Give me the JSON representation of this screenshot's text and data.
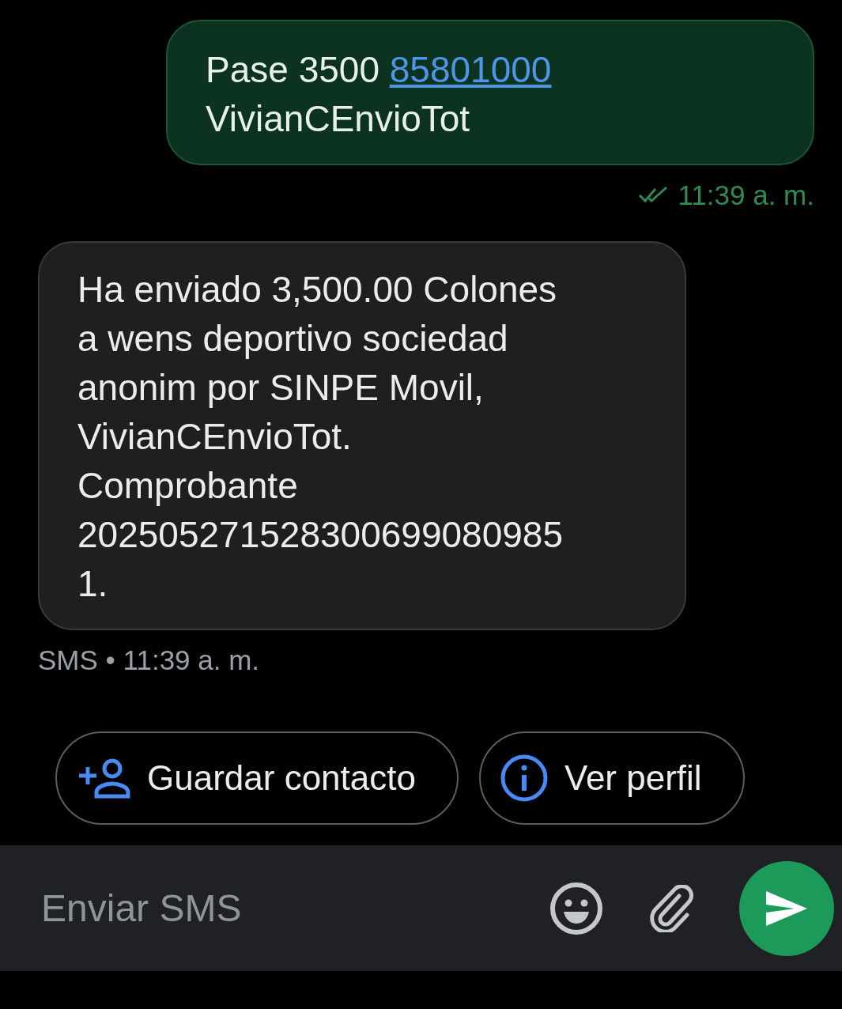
{
  "messages": [
    {
      "kind": "outgoing",
      "text_before": "Pase 3500 ",
      "link": "85801000",
      "lines_after": [
        "VivianCEnvioTot"
      ],
      "delivered": true,
      "time": "11:39 a. m."
    },
    {
      "kind": "incoming",
      "lines": [
        "Ha enviado 3,500.00 Colones",
        "a wens deportivo sociedad",
        "anonim por SINPE Movil,",
        "VivianCEnvioTot.",
        "Comprobante",
        "202505271528300699080985",
        "1."
      ],
      "channel": "SMS",
      "separator": "•",
      "time": "11:39 a. m."
    }
  ],
  "actions": [
    {
      "kind": "add-contact",
      "label": "Guardar contacto"
    },
    {
      "kind": "info",
      "label": "Ver perfil"
    }
  ],
  "composer": {
    "placeholder": "Enviar SMS"
  }
}
